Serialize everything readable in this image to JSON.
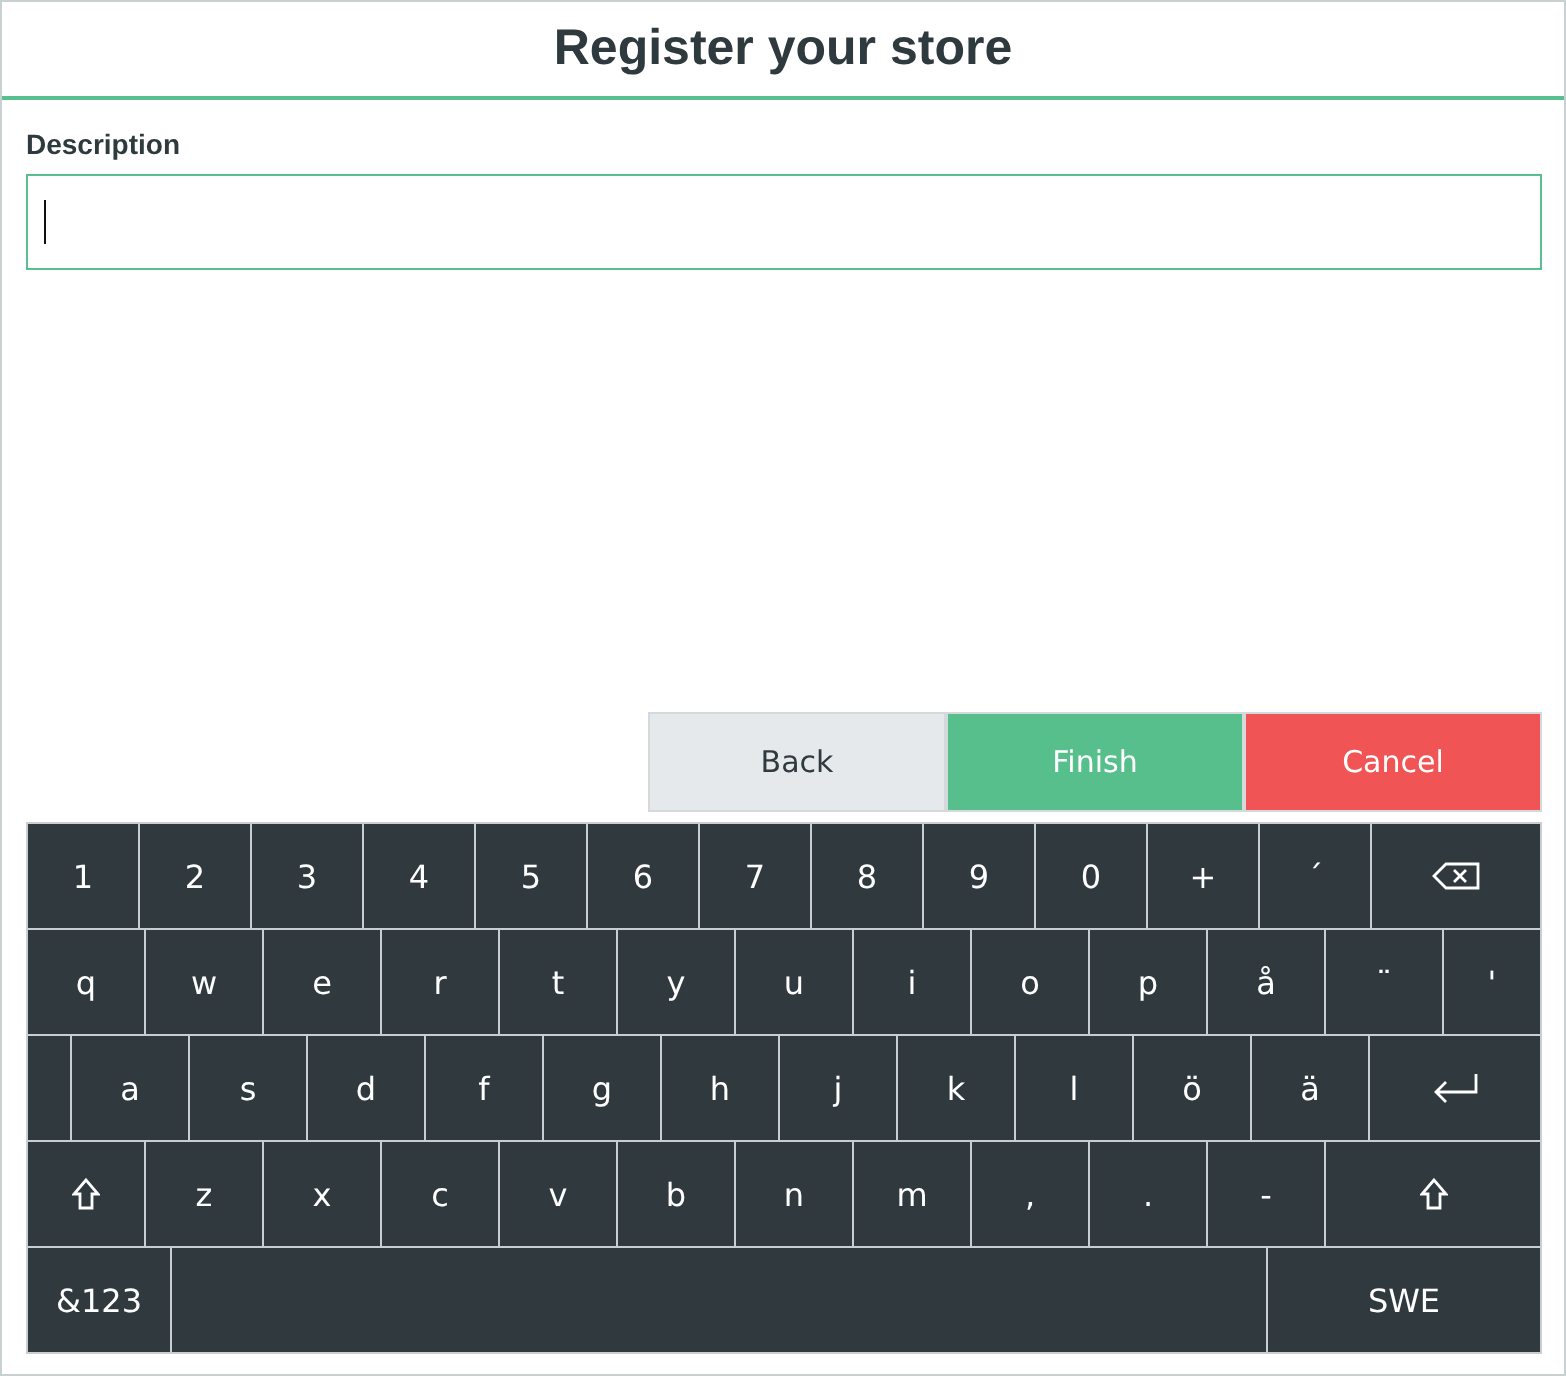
{
  "title": "Register your store",
  "field": {
    "label": "Description",
    "focused": true
  },
  "buttons": [
    {
      "label": "Back",
      "kind": "back"
    },
    {
      "label": "Finish",
      "kind": "finish"
    },
    {
      "label": "Cancel",
      "kind": "cancel"
    }
  ],
  "keyboard": {
    "rows": [
      [
        {
          "kind": "char",
          "label": "1"
        },
        {
          "kind": "char",
          "label": "2"
        },
        {
          "kind": "char",
          "label": "3"
        },
        {
          "kind": "char",
          "label": "4"
        },
        {
          "kind": "char",
          "label": "5"
        },
        {
          "kind": "char",
          "label": "6"
        },
        {
          "kind": "char",
          "label": "7"
        },
        {
          "kind": "char",
          "label": "8"
        },
        {
          "kind": "char",
          "label": "9"
        },
        {
          "kind": "char",
          "label": "0"
        },
        {
          "kind": "char",
          "label": "+"
        },
        {
          "kind": "char",
          "label": "´"
        },
        {
          "kind": "backspace"
        }
      ],
      [
        {
          "kind": "char",
          "label": "q"
        },
        {
          "kind": "char",
          "label": "w"
        },
        {
          "kind": "char",
          "label": "e"
        },
        {
          "kind": "char",
          "label": "r"
        },
        {
          "kind": "char",
          "label": "t"
        },
        {
          "kind": "char",
          "label": "y"
        },
        {
          "kind": "char",
          "label": "u"
        },
        {
          "kind": "char",
          "label": "i"
        },
        {
          "kind": "char",
          "label": "o"
        },
        {
          "kind": "char",
          "label": "p"
        },
        {
          "kind": "char",
          "label": "å"
        },
        {
          "kind": "char",
          "label": "¨"
        },
        {
          "kind": "char",
          "label": "'"
        }
      ],
      [
        {
          "kind": "blank"
        },
        {
          "kind": "char",
          "label": "a"
        },
        {
          "kind": "char",
          "label": "s"
        },
        {
          "kind": "char",
          "label": "d"
        },
        {
          "kind": "char",
          "label": "f"
        },
        {
          "kind": "char",
          "label": "g"
        },
        {
          "kind": "char",
          "label": "h"
        },
        {
          "kind": "char",
          "label": "j"
        },
        {
          "kind": "char",
          "label": "k"
        },
        {
          "kind": "char",
          "label": "l"
        },
        {
          "kind": "char",
          "label": "ö"
        },
        {
          "kind": "char",
          "label": "ä"
        },
        {
          "kind": "enter"
        }
      ],
      [
        {
          "kind": "shift"
        },
        {
          "kind": "char",
          "label": "z"
        },
        {
          "kind": "char",
          "label": "x"
        },
        {
          "kind": "char",
          "label": "c"
        },
        {
          "kind": "char",
          "label": "v"
        },
        {
          "kind": "char",
          "label": "b"
        },
        {
          "kind": "char",
          "label": "n"
        },
        {
          "kind": "char",
          "label": "m"
        },
        {
          "kind": "char",
          "label": ","
        },
        {
          "kind": "char",
          "label": "."
        },
        {
          "kind": "char",
          "label": "-"
        },
        {
          "kind": "shift"
        }
      ],
      [
        {
          "kind": "char",
          "label": "&123"
        },
        {
          "kind": "space"
        },
        {
          "kind": "char",
          "label": "SWE"
        }
      ]
    ]
  }
}
